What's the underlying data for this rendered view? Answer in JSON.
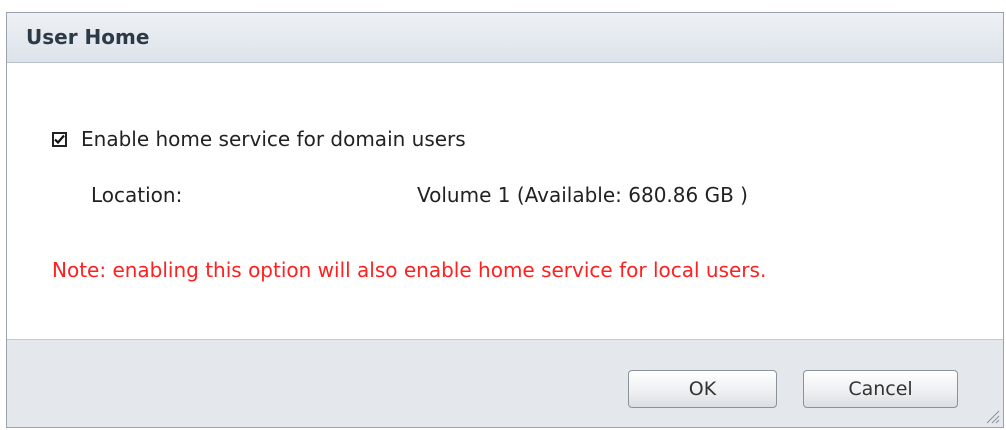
{
  "dialog": {
    "title": "User Home"
  },
  "home_service": {
    "checkbox_label": "Enable home service for domain users",
    "checked": true
  },
  "location": {
    "label": "Location:",
    "value": "Volume 1 (Available: 680.86 GB )"
  },
  "note": {
    "text": "Note: enabling this option will also enable home service for local users.",
    "color": "#ff2020"
  },
  "footer": {
    "ok_label": "OK",
    "cancel_label": "Cancel"
  },
  "icons": {
    "checkbox": "checkmark-icon",
    "resize": "resize-grip-icon"
  }
}
